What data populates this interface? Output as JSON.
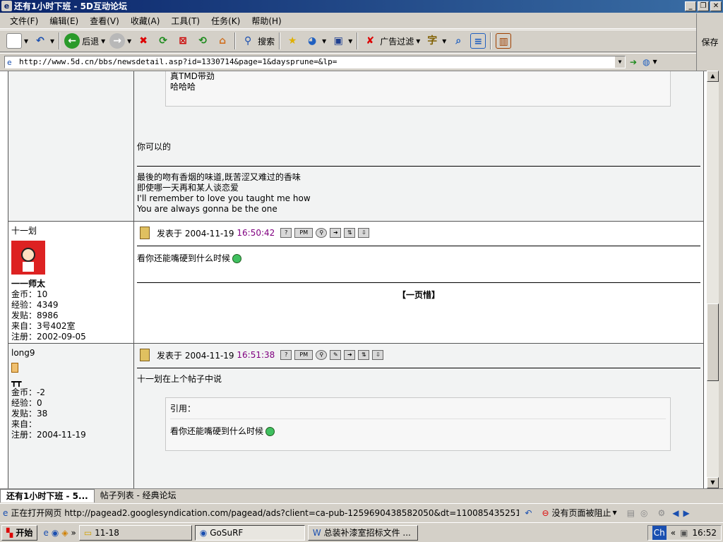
{
  "window": {
    "title": "还有1小时下班 - 5D互动论坛",
    "icon": "ie-icon"
  },
  "menu": [
    "文件(F)",
    "编辑(E)",
    "查看(V)",
    "收藏(A)",
    "工具(T)",
    "任务(K)",
    "帮助(H)"
  ],
  "save_label": "保存",
  "toolbar": {
    "back": "后退",
    "search": "搜索",
    "adfilter": "广告过滤"
  },
  "address": {
    "url": "http://www.5d.cn/bbs/newsdetail.asp?id=1330714&page=1&daysprune=&lp="
  },
  "posts": [
    {
      "quote_lines": [
        "真TMD带劲",
        "哈哈哈"
      ],
      "body": "你可以的",
      "signature": [
        "最後的吻有香烟的味道,既苦涩又难过的香味",
        "即使哪一天再和某人谈恋爱",
        "I'll remember to love you taught me how",
        "You are always gonna be the one"
      ]
    },
    {
      "author": "十一划",
      "rank": "一一师太",
      "coins": "金币：10",
      "exp": "经验：4349",
      "posts": "发贴：8986",
      "from": "来自：3号402室",
      "reg": "注册：2002-09-05",
      "posted_prefix": "发表于 2004-11-19",
      "posted_time": "16:50:42",
      "body": "看你还能嘴硬到什么时候",
      "sig": "【一页惜】"
    },
    {
      "author": "long9",
      "rank": "┳┳",
      "coins": "金币：-2",
      "exp": "经验：0",
      "posts": "发贴：38",
      "from": "来自：",
      "reg": "注册：2004-11-19",
      "posted_prefix": "发表于 2004-11-19",
      "posted_time": "16:51:38",
      "body": "十一划在上个帖子中说",
      "quote_title": "引用：",
      "quote_body": "看你还能嘴硬到什么时候"
    }
  ],
  "tabs": [
    "还有1小时下班 - 5...",
    "帖子列表 - 经典论坛"
  ],
  "status": {
    "text": "正在打开网页 http://pagead2.googlesyndication.com/pagead/ads?client=ca-pub-1259690438582050&dt=1100854352515&lmt...",
    "blocked": "没有页面被阻止"
  },
  "taskbar": {
    "start": "开始",
    "items": [
      "11-18",
      "GoSuRF",
      "总装补漆室招标文件 ..."
    ],
    "clock": "16:52"
  },
  "colors": {
    "title_bg": "#0a246a",
    "time_color": "#800080"
  }
}
